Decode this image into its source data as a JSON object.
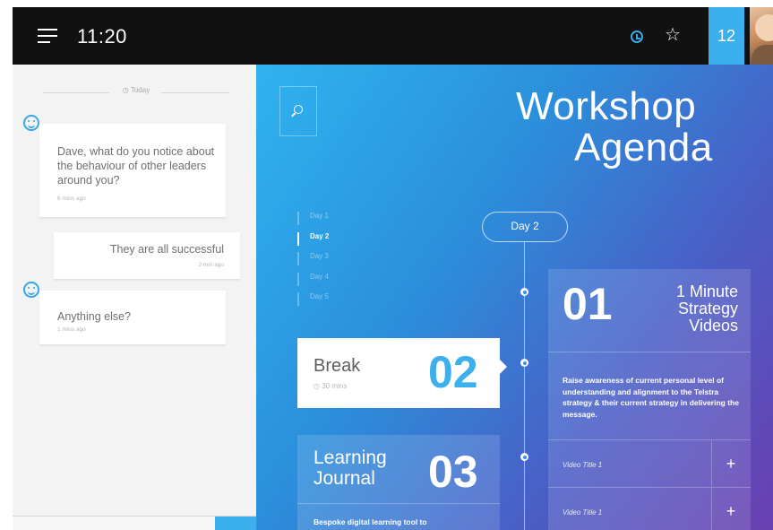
{
  "topbar": {
    "time": "11:20",
    "menu_icon": "hamburger-menu-icon",
    "clock_icon": "clock-icon",
    "star_icon": "star-icon",
    "badge_count": "12",
    "accent_color": "#3cb0ec"
  },
  "chat": {
    "date_label": "◷ Today",
    "messages": [
      {
        "from": "bot",
        "text": "Dave, what do you notice about the behaviour of other leaders around you?",
        "time": "6 mins ago"
      },
      {
        "from": "user",
        "text": "They are all successful",
        "time": "2 min ago"
      },
      {
        "from": "bot",
        "text": "Anything else?",
        "time": "1 mins ago"
      }
    ]
  },
  "agenda": {
    "title_line1": "Workshop",
    "title_line2": "Agenda",
    "days": [
      "Day 1",
      "Day 2",
      "Day 3",
      "Day 4",
      "Day 5"
    ],
    "active_day": "Day 2",
    "current_day_pill": "Day 2",
    "sessions": {
      "break": {
        "name": "Break",
        "duration": "◷ 30 mins",
        "number": "02"
      },
      "learning": {
        "name": "Learning Journal",
        "number": "03",
        "description": "Bespoke digital learning tool to"
      },
      "video": {
        "number": "01",
        "title": "1 Minute Strategy Videos",
        "description": "Raise awareness of current personal level of understanding and alignment to the Telstra strategy & their current strategy in delivering the message.",
        "items": [
          "Video Title 1",
          "Video Title 1"
        ],
        "add_symbol": "+"
      }
    },
    "gradient_colors": [
      "#2fb3ef",
      "#2b8fdc",
      "#4a5ec6",
      "#6a3fb0"
    ]
  }
}
